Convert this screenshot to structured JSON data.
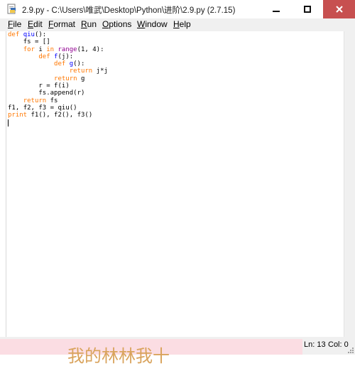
{
  "window": {
    "title": "2.9.py - C:\\Users\\唯武\\Desktop\\Python\\进阶\\2.9.py (2.7.15)",
    "close_color": "#c75050"
  },
  "menu": [
    {
      "label": "File",
      "mnemonic": "F",
      "rest": "ile"
    },
    {
      "label": "Edit",
      "mnemonic": "E",
      "rest": "dit"
    },
    {
      "label": "Format",
      "mnemonic": "F",
      "rest": "ormat"
    },
    {
      "label": "Run",
      "mnemonic": "R",
      "rest": "un"
    },
    {
      "label": "Options",
      "mnemonic": "O",
      "rest": "ptions"
    },
    {
      "label": "Window",
      "mnemonic": "W",
      "rest": "indow"
    },
    {
      "label": "Help",
      "mnemonic": "H",
      "rest": "elp"
    }
  ],
  "editor": {
    "lines": [
      "def qiu():",
      "    fs = []",
      "    for i in range(1, 4):",
      "        def f(j):",
      "            def g():",
      "                return j*j",
      "            return g",
      "        r = f(i)",
      "        fs.append(r)",
      "    return fs",
      "f1, f2, f3 = qiu()",
      "print f1(), f2(), f3()",
      ""
    ],
    "syntax_colors": {
      "keyword": "#ff7700",
      "definition": "#0000ff",
      "builtin": "#900090"
    }
  },
  "status": {
    "ln": "Ln: 13",
    "col": "Col: 0"
  },
  "overlay": {
    "text": "我的林林我十"
  }
}
